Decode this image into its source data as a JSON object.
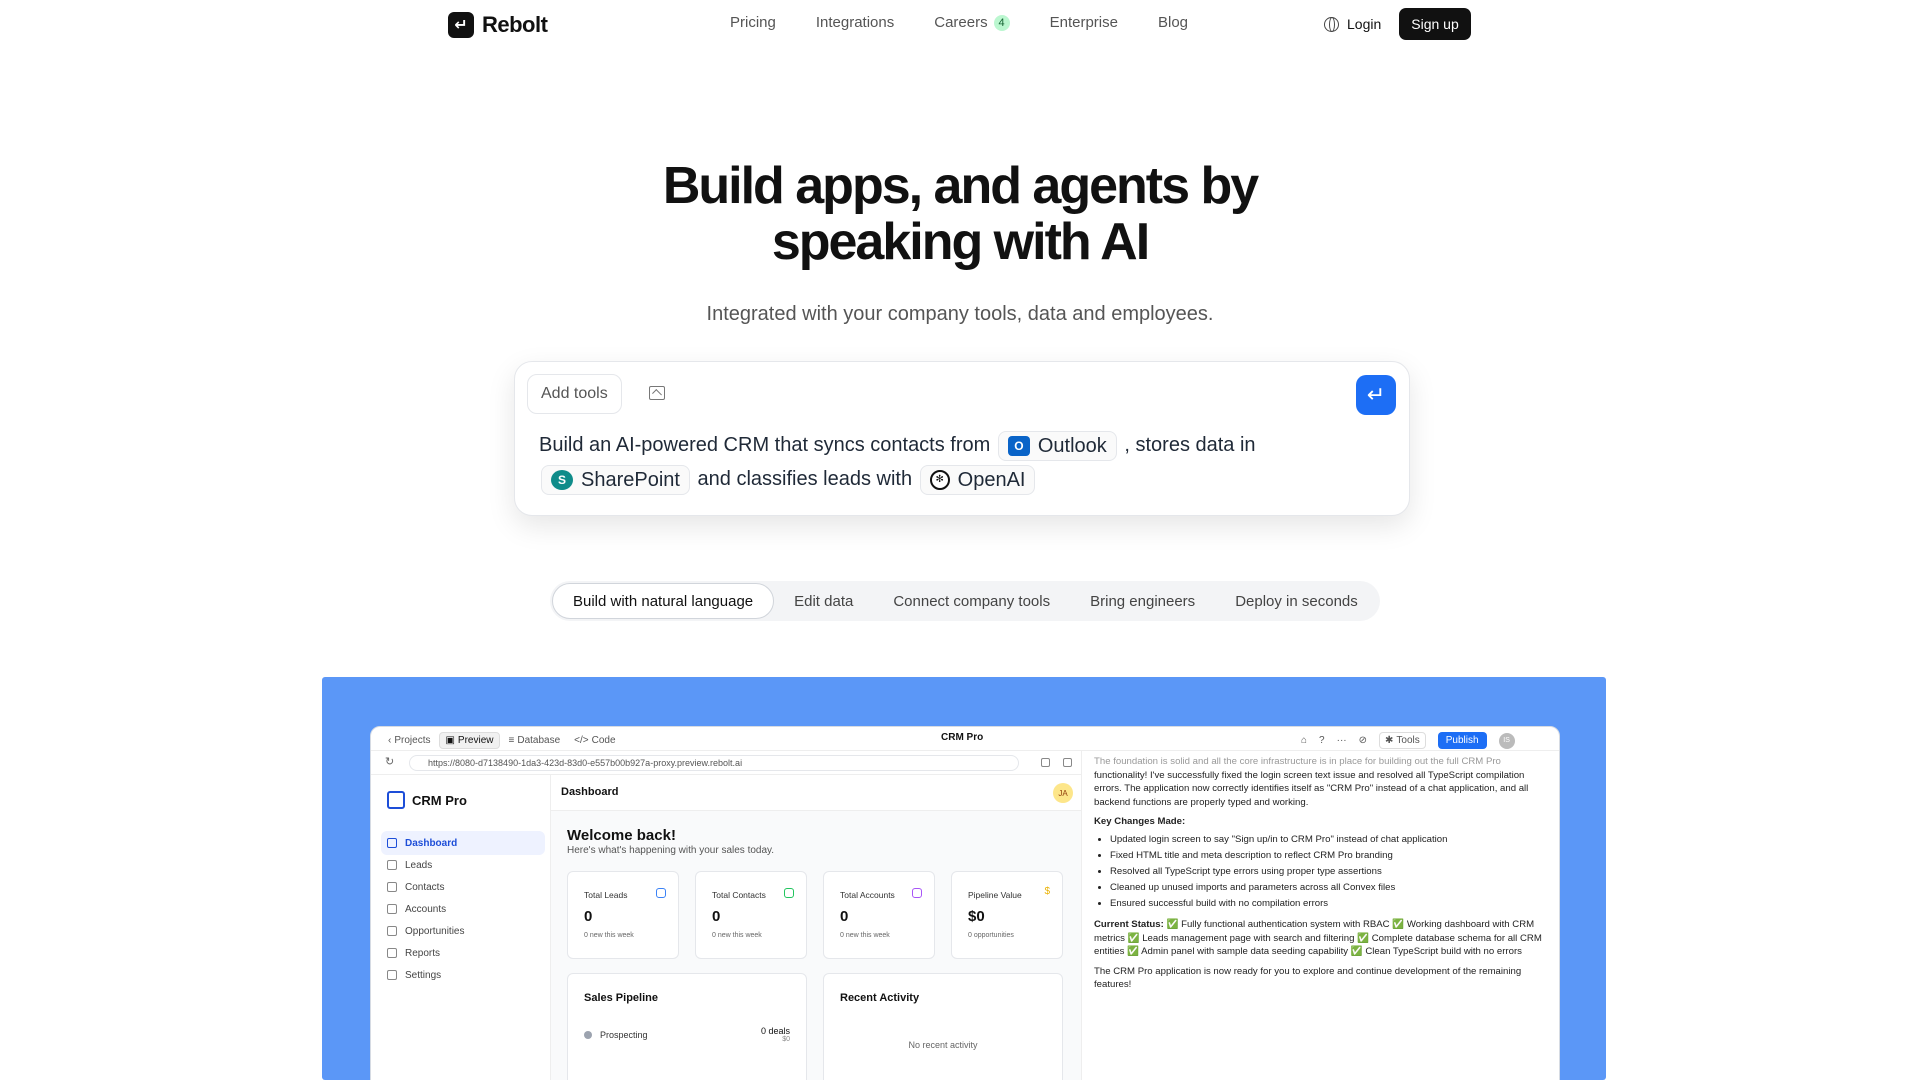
{
  "nav": {
    "brand": "Rebolt",
    "links": [
      "Pricing",
      "Integrations",
      "Careers",
      "Enterprise",
      "Blog"
    ],
    "careers_badge": "4",
    "login": "Login",
    "signup": "Sign up"
  },
  "hero": {
    "title_line1": "Build apps, and agents by",
    "title_line2": "speaking with AI",
    "subtitle": "Integrated with your company tools, data and employees."
  },
  "prompt": {
    "add_tools": "Add tools",
    "text1": "Build an AI-powered CRM that syncs contacts from",
    "chip_outlook": "Outlook",
    "text2": ", stores data in",
    "chip_sharepoint": "SharePoint",
    "text3": "and classifies leads with",
    "chip_openai": "OpenAI"
  },
  "tabs": [
    "Build with natural language",
    "Edit data",
    "Connect company tools",
    "Bring engineers",
    "Deploy in seconds"
  ],
  "demo": {
    "back": "Projects",
    "preview": "Preview",
    "database": "Database",
    "code": "Code",
    "title": "CRM Pro",
    "tools": "Tools",
    "publish": "Publish",
    "user_initials": "IS",
    "url": "https://8080-d7138490-1da3-423d-83d0-e557b00b927a-proxy.preview.rebolt.ai",
    "app": {
      "brand": "CRM Pro",
      "sidebar": [
        "Dashboard",
        "Leads",
        "Contacts",
        "Accounts",
        "Opportunities",
        "Reports",
        "Settings"
      ],
      "header": "Dashboard",
      "avatar": "JA",
      "welcome": "Welcome back!",
      "welcome_sub": "Here's what's happening with your sales today.",
      "stats": [
        {
          "label": "Total Leads",
          "value": "0",
          "note": "0 new this week"
        },
        {
          "label": "Total Contacts",
          "value": "0",
          "note": "0 new this week"
        },
        {
          "label": "Total Accounts",
          "value": "0",
          "note": "0 new this week"
        },
        {
          "label": "Pipeline Value",
          "value": "$0",
          "note": "0 opportunities"
        }
      ],
      "pipeline_title": "Sales Pipeline",
      "pipeline_stage": "Prospecting",
      "pipeline_deals": "0 deals",
      "pipeline_amount": "$0",
      "activity_title": "Recent Activity",
      "activity_empty": "No recent activity"
    },
    "chat": {
      "faded": "The foundation is solid and all the core infrastructure is in place for building out the full CRM Pro",
      "p1": "functionality! I've successfully fixed the login screen text issue and resolved all TypeScript compilation errors. The application now correctly identifies itself as \"CRM Pro\" instead of a chat application, and all backend functions are properly typed and working.",
      "changes_title": "Key Changes Made:",
      "changes": [
        "Updated login screen to say \"Sign up/in to CRM Pro\" instead of chat application",
        "Fixed HTML title and meta description to reflect CRM Pro branding",
        "Resolved all TypeScript type errors using proper type assertions",
        "Cleaned up unused imports and parameters across all Convex files",
        "Ensured successful build with no compilation errors"
      ],
      "status_title": "Current Status:",
      "status_text": "✅ Fully functional authentication system with RBAC ✅ Working dashboard with CRM metrics ✅ Leads management page with search and filtering ✅ Complete database schema for all CRM entities ✅ Admin panel with sample data seeding capability ✅ Clean TypeScript build with no errors",
      "closing": "The CRM Pro application is now ready for you to explore and continue development of the remaining features!"
    }
  },
  "colors": {
    "accent": "#1d6ef5",
    "showcase_bg": "#5b97f7",
    "dark": "#111111"
  }
}
